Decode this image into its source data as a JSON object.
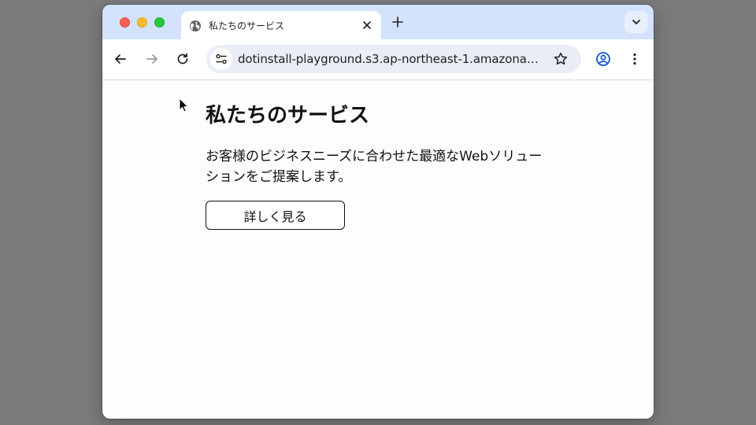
{
  "browser": {
    "tab_title": "私たちのサービス",
    "url": "dotinstall-playground.s3.ap-northeast-1.amazonaw...",
    "icons": {
      "favicon": "globe-icon",
      "close": "close-icon",
      "new_tab": "plus-icon",
      "tab_search": "chevron-down-icon",
      "back": "back-arrow-icon",
      "forward": "forward-arrow-icon",
      "reload": "reload-icon",
      "site_info": "tune-icon",
      "bookmark": "star-icon",
      "profile": "profile-icon",
      "menu": "kebab-menu-icon"
    },
    "colors": {
      "tab_strip": "#d3e3fd",
      "omnibox": "#e9eef6",
      "profile_accent": "#0b57d0"
    }
  },
  "page": {
    "title": "私たちのサービス",
    "description": "お客様のビジネスニーズに合わせた最適なWebソリューションをご提案します。",
    "button_label": "詳しく見る"
  }
}
